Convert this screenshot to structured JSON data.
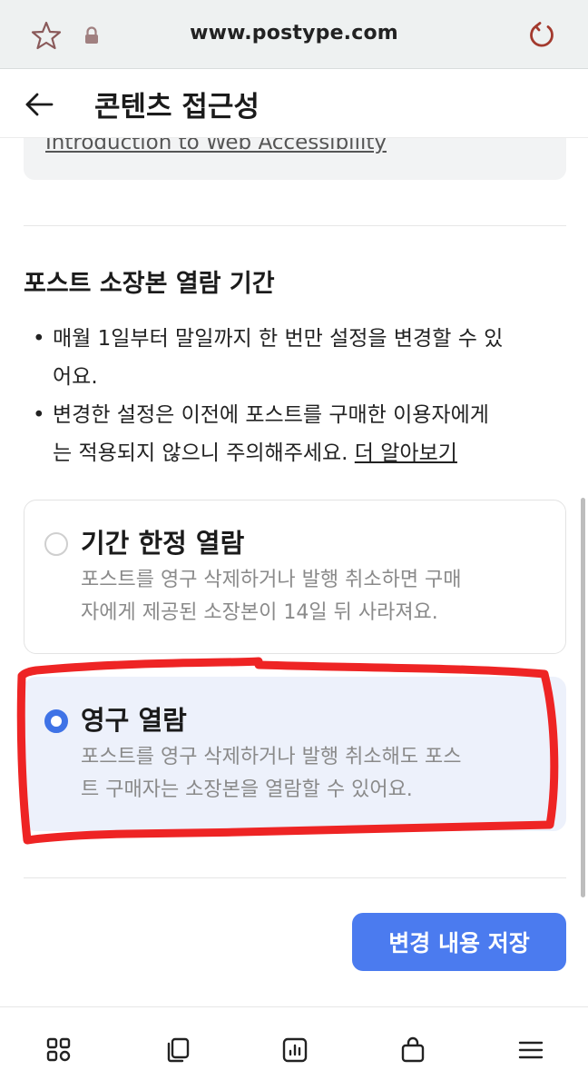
{
  "browser": {
    "url": "www.postype.com",
    "icons": [
      "star-icon",
      "lock-icon",
      "reload-icon"
    ]
  },
  "header": {
    "title": "콘텐츠 접근성",
    "back_icon": "back-arrow-icon"
  },
  "reference": {
    "link_text": "Introduction to Web Accessibility"
  },
  "section": {
    "title": "포스트 소장본 열람 기간",
    "notes": [
      {
        "bullet": "•",
        "line1": "매월 1일부터 말일까지 한 번만 설정을 변경할 수 있",
        "line2": "어요."
      },
      {
        "bullet": "•",
        "line1": "변경한 설정은 이전에 포스트를 구매한 이용자에게",
        "line2": "는 적용되지 않으니 주의해주세요.",
        "more_link": "더 알아보기"
      }
    ]
  },
  "options": [
    {
      "label": "기간 한정 열람",
      "desc_line1": "포스트를 영구 삭제하거나 발행 취소하면 구매",
      "desc_line2": "자에게 제공된 소장본이 14일 뒤 사라져요.",
      "selected": false
    },
    {
      "label": "영구 열람",
      "desc_line1": "포스트를 영구 삭제하거나 발행 취소해도 포스",
      "desc_line2": "트 구매자는 소장본을 열람할 수 있어요.",
      "selected": true
    }
  ],
  "save_button": {
    "label": "변경 내용 저장"
  },
  "bottom_nav": {
    "items": [
      "dashboard-icon",
      "copy-icon",
      "chart-icon",
      "bag-icon",
      "menu-icon"
    ]
  },
  "colors": {
    "accent": "#4b7bef",
    "radio_checked": "#3f73e6",
    "selected_bg": "#edf1fb",
    "highlight_stroke": "#ee2424",
    "reload_icon": "#a33a2e"
  }
}
